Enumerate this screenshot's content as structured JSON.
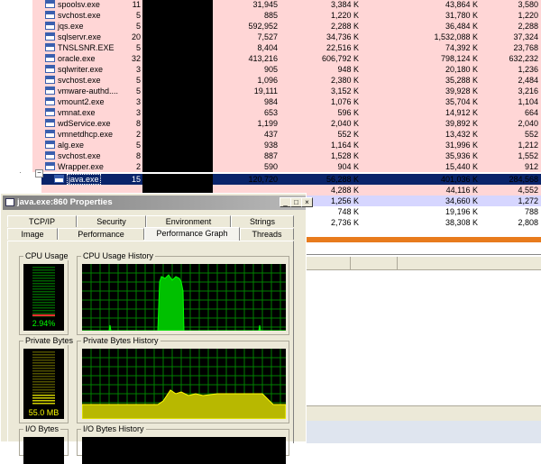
{
  "processes": [
    {
      "name": "spoolsv.exe",
      "priority": "11",
      "c1": "31,945",
      "c2": "3,384 K",
      "c3": "43,864 K",
      "c4": "3,580",
      "style": "pink"
    },
    {
      "name": "svchost.exe",
      "priority": "5",
      "c1": "885",
      "c2": "1,220 K",
      "c3": "31,780 K",
      "c4": "1,220",
      "style": "pink"
    },
    {
      "name": "jqs.exe",
      "priority": "5",
      "c1": "592,952",
      "c2": "2,288 K",
      "c3": "36,484 K",
      "c4": "2,288",
      "style": "pink"
    },
    {
      "name": "sqlservr.exe",
      "priority": "20",
      "c1": "7,527",
      "c2": "34,736 K",
      "c3": "1,532,088 K",
      "c4": "37,324",
      "style": "pink"
    },
    {
      "name": "TNSLSNR.EXE",
      "priority": "5",
      "c1": "8,404",
      "c2": "22,516 K",
      "c3": "74,392 K",
      "c4": "23,768",
      "style": "pink"
    },
    {
      "name": "oracle.exe",
      "priority": "32",
      "c1": "413,216",
      "c2": "606,792 K",
      "c3": "798,124 K",
      "c4": "632,232",
      "style": "pink"
    },
    {
      "name": "sqlwriter.exe",
      "priority": "3",
      "c1": "905",
      "c2": "948 K",
      "c3": "20,180 K",
      "c4": "1,236",
      "style": "pink"
    },
    {
      "name": "svchost.exe",
      "priority": "5",
      "c1": "1,096",
      "c2": "2,380 K",
      "c3": "35,288 K",
      "c4": "2,484",
      "style": "pink"
    },
    {
      "name": "vmware-authd....",
      "priority": "5",
      "c1": "19,111",
      "c2": "3,152 K",
      "c3": "39,928 K",
      "c4": "3,216",
      "style": "pink"
    },
    {
      "name": "vmount2.exe",
      "priority": "3",
      "c1": "984",
      "c2": "1,076 K",
      "c3": "35,704 K",
      "c4": "1,104",
      "style": "pink"
    },
    {
      "name": "vmnat.exe",
      "priority": "3",
      "c1": "653",
      "c2": "596 K",
      "c3": "14,912 K",
      "c4": "664",
      "style": "pink"
    },
    {
      "name": "wdService.exe",
      "priority": "8",
      "c1": "1,199",
      "c2": "2,040 K",
      "c3": "39,892 K",
      "c4": "2,040",
      "style": "pink"
    },
    {
      "name": "vmnetdhcp.exe",
      "priority": "2",
      "c1": "437",
      "c2": "552 K",
      "c3": "13,432 K",
      "c4": "552",
      "style": "pink"
    },
    {
      "name": "alg.exe",
      "priority": "5",
      "c1": "938",
      "c2": "1,164 K",
      "c3": "31,996 K",
      "c4": "1,212",
      "style": "pink"
    },
    {
      "name": "svchost.exe",
      "priority": "8",
      "c1": "887",
      "c2": "1,528 K",
      "c3": "35,936 K",
      "c4": "1,552",
      "style": "pink"
    },
    {
      "name": "Wrapper.exe",
      "priority": "2",
      "c1": "590",
      "c2": "904 K",
      "c3": "15,440 K",
      "c4": "912",
      "style": "pink"
    },
    {
      "name": "java.exe",
      "priority": "15",
      "c1": "120,720",
      "c2": "56,288 K",
      "c3": "401,036 K",
      "c4": "284,568",
      "style": "sel"
    },
    {
      "name": "",
      "priority": "",
      "c1": "",
      "c2": "4,288 K",
      "c3": "44,116 K",
      "c4": "4,552",
      "style": "pink"
    },
    {
      "name": "",
      "priority": "",
      "c1": "",
      "c2": "1,256 K",
      "c3": "34,660 K",
      "c4": "1,272",
      "style": "lav"
    },
    {
      "name": "",
      "priority": "",
      "c1": "",
      "c2": "748 K",
      "c3": "19,196 K",
      "c4": "788",
      "style": "white"
    },
    {
      "name": "",
      "priority": "",
      "c1": "",
      "c2": "2,736 K",
      "c3": "38,308 K",
      "c4": "2,808",
      "style": "white"
    }
  ],
  "dialog": {
    "title": "java.exe:860 Properties",
    "buttons": {
      "minimize": "_",
      "maximize": "□",
      "close": "×"
    },
    "tabs_row1": [
      "TCP/IP",
      "Security",
      "Environment",
      "Strings"
    ],
    "tabs_row2": [
      "Image",
      "Performance",
      "Performance Graph",
      "Threads"
    ],
    "active_tab": "Performance Graph",
    "groups": {
      "cpu_usage": "CPU Usage",
      "cpu_history": "CPU Usage History",
      "private_bytes": "Private Bytes",
      "private_history": "Private Bytes History",
      "io_bytes": "I/O Bytes",
      "io_history": "I/O Bytes History"
    },
    "cpu_value": "2.94%",
    "private_value": "55.0 MB"
  },
  "colors": {
    "graph_bg": "#000000",
    "grid": "#008000",
    "cpu_fill": "#00c000",
    "mem_fill": "#b8b800",
    "selection": "#0a246a",
    "row_pink": "#ffd6d6"
  }
}
